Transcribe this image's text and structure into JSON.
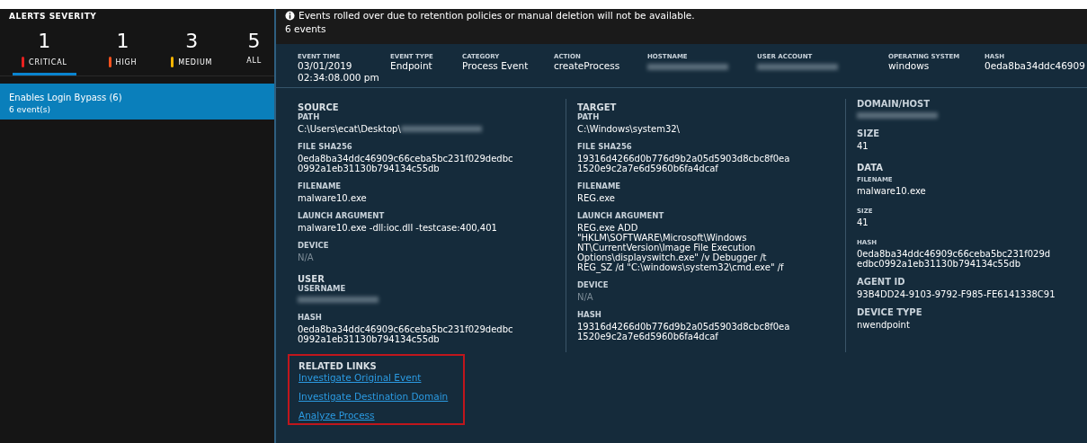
{
  "sidebar": {
    "title": "ALERTS SEVERITY",
    "severities": [
      {
        "count": "1",
        "label": "CRITICAL",
        "color": "#e8201f",
        "selected": true
      },
      {
        "count": "1",
        "label": "HIGH",
        "color": "#f4511e",
        "selected": false
      },
      {
        "count": "3",
        "label": "MEDIUM",
        "color": "#f5b400",
        "selected": false
      },
      {
        "count": "5",
        "label": "ALL",
        "selected": false
      }
    ],
    "alerts": [
      {
        "name": "Enables Login Bypass (6)",
        "events": "6 event(s)",
        "selected": true
      }
    ]
  },
  "notice": "Events rolled over due to retention policies or manual deletion will not be available.",
  "event_count": "6 events",
  "summary": [
    {
      "label": "EVENT TIME",
      "lines": [
        "03/01/2019",
        "02:34:08.000 pm"
      ]
    },
    {
      "label": "EVENT TYPE",
      "lines": [
        "Endpoint"
      ]
    },
    {
      "label": "CATEGORY",
      "lines": [
        "Process Event"
      ]
    },
    {
      "label": "ACTION",
      "lines": [
        "createProcess"
      ]
    },
    {
      "label": "HOSTNAME",
      "redacted": true
    },
    {
      "label": "USER ACCOUNT",
      "redacted": true
    },
    {
      "label": "OPERATING SYSTEM",
      "lines": [
        "windows"
      ]
    },
    {
      "label": "HASH",
      "lines": [
        "0eda8ba34ddc46909"
      ]
    }
  ],
  "columns": [
    {
      "items": [
        {
          "kind": "group",
          "label": "SOURCE"
        },
        {
          "kind": "field",
          "label": "PATH",
          "lines": [
            "C:\\Users\\ecat\\Desktop\\"
          ],
          "redacted": true
        },
        {
          "kind": "field",
          "label": "FILE SHA256",
          "lines": [
            "0eda8ba34ddc46909c66ceba5bc231f029dedbc",
            "0992a1eb31130b794134c55db"
          ]
        },
        {
          "kind": "field",
          "label": "FILENAME",
          "lines": [
            "malware10.exe"
          ]
        },
        {
          "kind": "field",
          "label": "LAUNCH ARGUMENT",
          "lines": [
            "malware10.exe -dll:ioc.dll -testcase:400,401"
          ]
        },
        {
          "kind": "field",
          "label": "DEVICE",
          "lines": [
            "N/A"
          ],
          "muted": true
        },
        {
          "kind": "group",
          "label": "USER"
        },
        {
          "kind": "field",
          "label": "USERNAME",
          "redacted": true
        },
        {
          "kind": "field",
          "label": "HASH",
          "lines": [
            "0eda8ba34ddc46909c66ceba5bc231f029dedbc",
            "0992a1eb31130b794134c55db"
          ]
        }
      ]
    },
    {
      "items": [
        {
          "kind": "group",
          "label": "TARGET"
        },
        {
          "kind": "field",
          "label": "PATH",
          "lines": [
            "C:\\Windows\\system32\\"
          ]
        },
        {
          "kind": "field",
          "label": "FILE SHA256",
          "lines": [
            "19316d4266d0b776d9b2a05d5903d8cbc8f0ea",
            "1520e9c2a7e6d5960b6fa4dcaf"
          ]
        },
        {
          "kind": "field",
          "label": "FILENAME",
          "lines": [
            "REG.exe"
          ]
        },
        {
          "kind": "field",
          "label": "LAUNCH ARGUMENT",
          "lines": [
            "REG.exe ADD",
            "\"HKLM\\SOFTWARE\\Microsoft\\Windows",
            "NT\\CurrentVersion\\Image File Execution",
            "Options\\displayswitch.exe\" /v Debugger /t",
            "REG_SZ /d \"C:\\windows\\system32\\cmd.exe\" /f"
          ]
        },
        {
          "kind": "field",
          "label": "DEVICE",
          "lines": [
            "N/A"
          ],
          "muted": true
        },
        {
          "kind": "field",
          "label": "HASH",
          "lines": [
            "19316d4266d0b776d9b2a05d5903d8cbc8f0ea",
            "1520e9c2a7e6d5960b6fa4dcaf"
          ]
        }
      ]
    },
    {
      "items": [
        {
          "kind": "field",
          "label": "DOMAIN/HOST",
          "redacted": true,
          "big": true
        },
        {
          "kind": "field",
          "label": "SIZE",
          "lines": [
            "41"
          ],
          "big": true
        },
        {
          "kind": "group",
          "label": "DATA"
        },
        {
          "kind": "subfield",
          "label": "FILENAME",
          "lines": [
            "malware10.exe"
          ]
        },
        {
          "kind": "subfield",
          "label": "SIZE",
          "lines": [
            "41"
          ]
        },
        {
          "kind": "subfield",
          "label": "HASH",
          "lines": [
            "0eda8ba34ddc46909c66ceba5bc231f029d",
            "edbc0992a1eb31130b794134c55db"
          ]
        },
        {
          "kind": "field",
          "label": "AGENT ID",
          "lines": [
            "93B4DD24-9103-9792-F985-FE6141338C91"
          ],
          "big": true
        },
        {
          "kind": "field",
          "label": "DEVICE TYPE",
          "lines": [
            "nwendpoint"
          ],
          "big": true
        }
      ]
    }
  ],
  "related_links": {
    "title": "RELATED LINKS",
    "highlighted": true,
    "links": [
      "Investigate Original Event",
      "Investigate Destination Domain",
      "Analyze Process"
    ]
  }
}
